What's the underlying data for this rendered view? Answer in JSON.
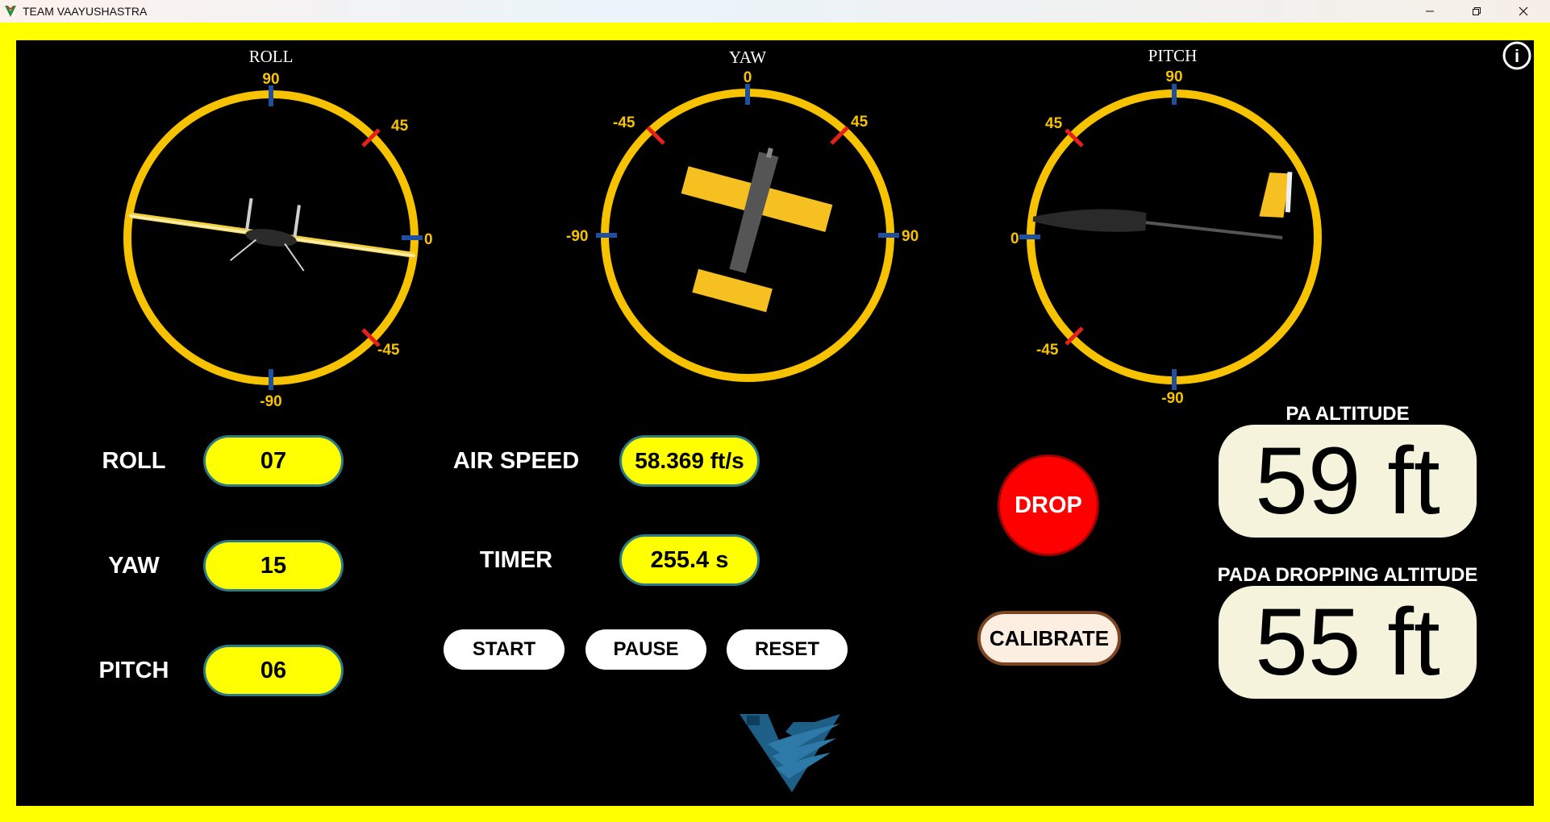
{
  "window": {
    "title": "TEAM VAAYUSHASTRA",
    "icon": "app-logo-icon",
    "controls": [
      "minimize-icon",
      "restore-icon",
      "close-icon"
    ]
  },
  "colors": {
    "frame": "#ffff00",
    "panel": "#000000",
    "ring": "#f7c300",
    "tick_major": "#1e4fa0",
    "tick_minor": "#e8201c",
    "pill": "#ffff00",
    "drop": "#ff0000"
  },
  "gauges": {
    "roll": {
      "title": "ROLL",
      "ticks": {
        "top": "90",
        "upper_right": "45",
        "right": "0",
        "lower_right": "-45",
        "bottom": "-90"
      }
    },
    "yaw": {
      "title": "YAW",
      "ticks": {
        "top": "0",
        "upper_left": "-45",
        "upper_right": "45",
        "left": "-90",
        "right": "90"
      }
    },
    "pitch": {
      "title": "PITCH",
      "ticks": {
        "top": "90",
        "upper_left": "45",
        "left": "0",
        "lower_left": "-45",
        "bottom": "-90"
      }
    }
  },
  "readouts": {
    "roll": {
      "label": "ROLL",
      "value": "07"
    },
    "yaw": {
      "label": "YAW",
      "value": "15"
    },
    "pitch": {
      "label": "PITCH",
      "value": "06"
    },
    "air_speed": {
      "label": "AIR SPEED",
      "value": "58.369 ft/s"
    },
    "timer": {
      "label": "TIMER",
      "value": "255.4 s"
    }
  },
  "buttons": {
    "start": "START",
    "pause": "PAUSE",
    "reset": "RESET",
    "drop": "DROP",
    "calibrate": "CALIBRATE",
    "info": "i"
  },
  "altitude": {
    "pa_title": "PA ALTITUDE",
    "pa_value": "59 ft",
    "pada_title": "PADA DROPPING ALTITUDE",
    "pada_value": "55 ft"
  }
}
